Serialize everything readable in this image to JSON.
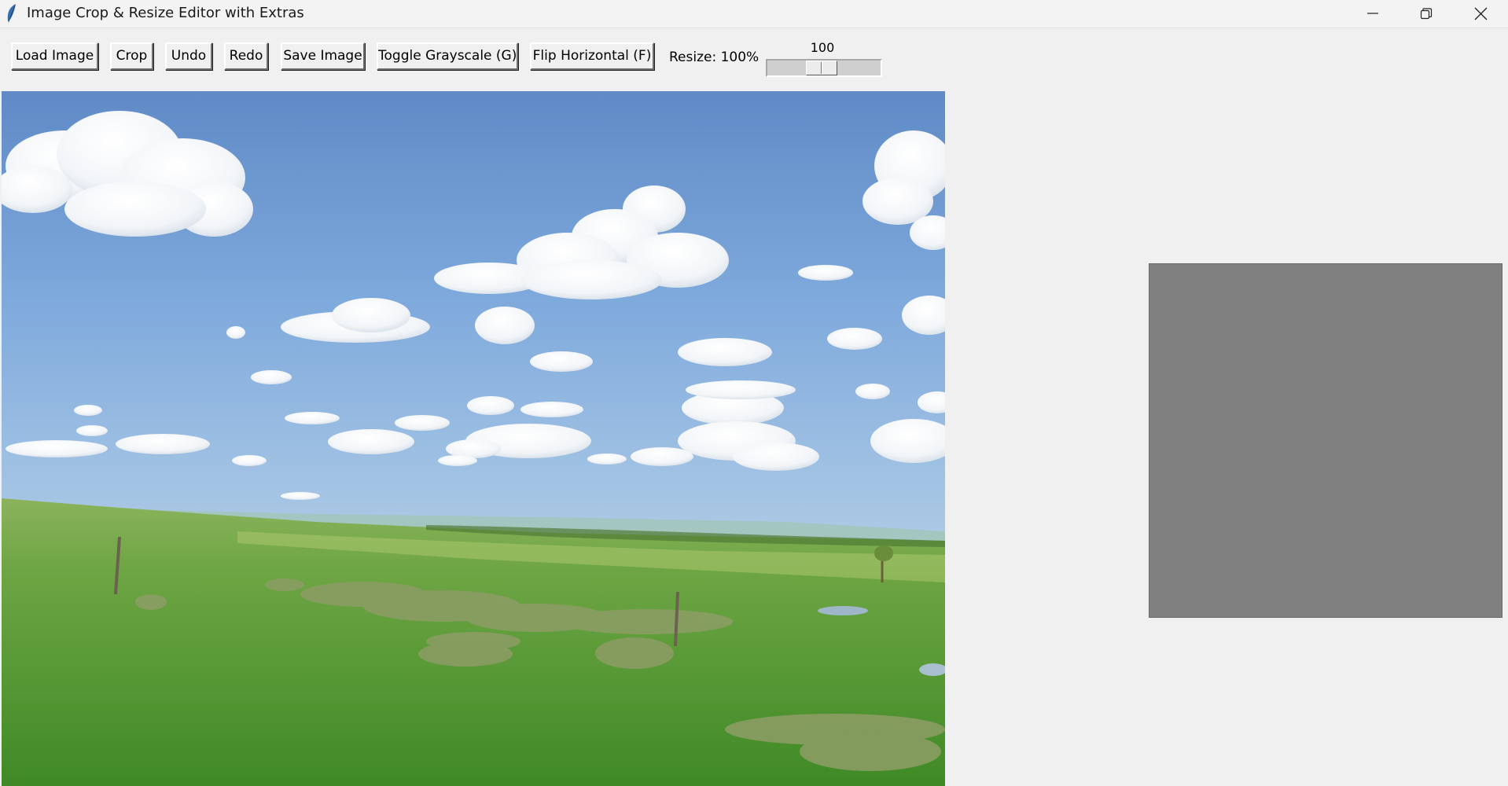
{
  "window": {
    "title": "Image Crop & Resize Editor with Extras",
    "app_icon": "feather-icon",
    "controls": {
      "minimize_icon": "minimize-icon",
      "maximize_icon": "restore-icon",
      "close_icon": "close-icon"
    }
  },
  "toolbar": {
    "buttons": [
      {
        "id": "load",
        "label": "Load Image"
      },
      {
        "id": "crop",
        "label": "Crop"
      },
      {
        "id": "undo",
        "label": "Undo"
      },
      {
        "id": "redo",
        "label": "Redo"
      },
      {
        "id": "save",
        "label": "Save Image"
      },
      {
        "id": "grayscale",
        "label": "Toggle Grayscale (G)"
      },
      {
        "id": "flip",
        "label": "Flip Horizontal (F)"
      }
    ],
    "resize_label": "Resize: 100%",
    "scale": {
      "value": "100",
      "min": 10,
      "max": 200,
      "current": 100
    }
  },
  "canvas": {
    "image_subject": "grassland landscape with blue sky and white clouds"
  },
  "preview": {
    "color": "#808080"
  },
  "colors": {
    "window_bg": "#f0f0f0",
    "sky_top": "#5f8ac6",
    "sky_bottom": "#a9c9e6",
    "grass": "#5a9a34"
  }
}
